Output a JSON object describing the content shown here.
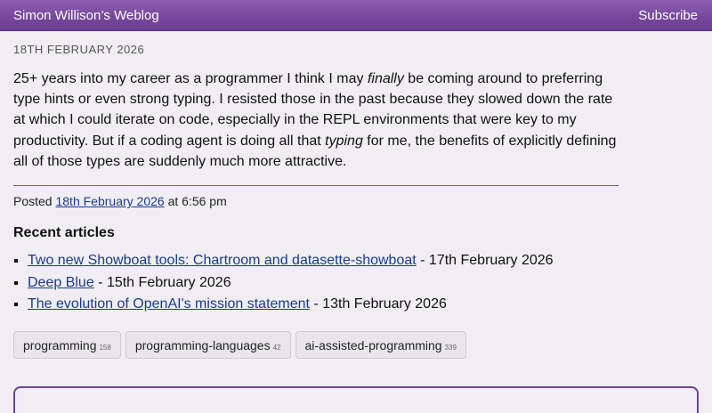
{
  "header": {
    "site_title": "Simon Willison’s Weblog",
    "subscribe_label": "Subscribe"
  },
  "entry": {
    "date": "18th February 2026",
    "text_1": "25+ years into my career as a programmer I think I may ",
    "emphasis_1": "finally",
    "text_2": " be coming around to preferring type hints or even strong typing. I resisted those in the past because they slowed down the rate at which I could iterate on code, especially in the REPL environments that were key to my productivity. But if a coding agent is doing all that ",
    "emphasis_2": "typing",
    "text_3": " for me, the benefits of explicitly defining all of those types are suddenly much more attractive."
  },
  "posted": {
    "prefix": "Posted ",
    "date_link": "18th February 2026",
    "suffix": " at 6:56 pm"
  },
  "recent": {
    "heading": "Recent articles",
    "items": [
      {
        "title": "Two new Showboat tools: Chartroom and datasette-showboat",
        "date": " - 17th February 2026"
      },
      {
        "title": "Deep Blue",
        "date": " - 15th February 2026"
      },
      {
        "title": "The evolution of OpenAI's mission statement",
        "date": " - 13th February 2026"
      }
    ]
  },
  "tags": [
    {
      "label": "programming",
      "count": "158"
    },
    {
      "label": "programming-languages",
      "count": "42"
    },
    {
      "label": "ai-assisted-programming",
      "count": "339"
    }
  ],
  "colors": {
    "header_bg": "#74479a",
    "link": "#1a3a8f",
    "accent": "#6f429a"
  }
}
